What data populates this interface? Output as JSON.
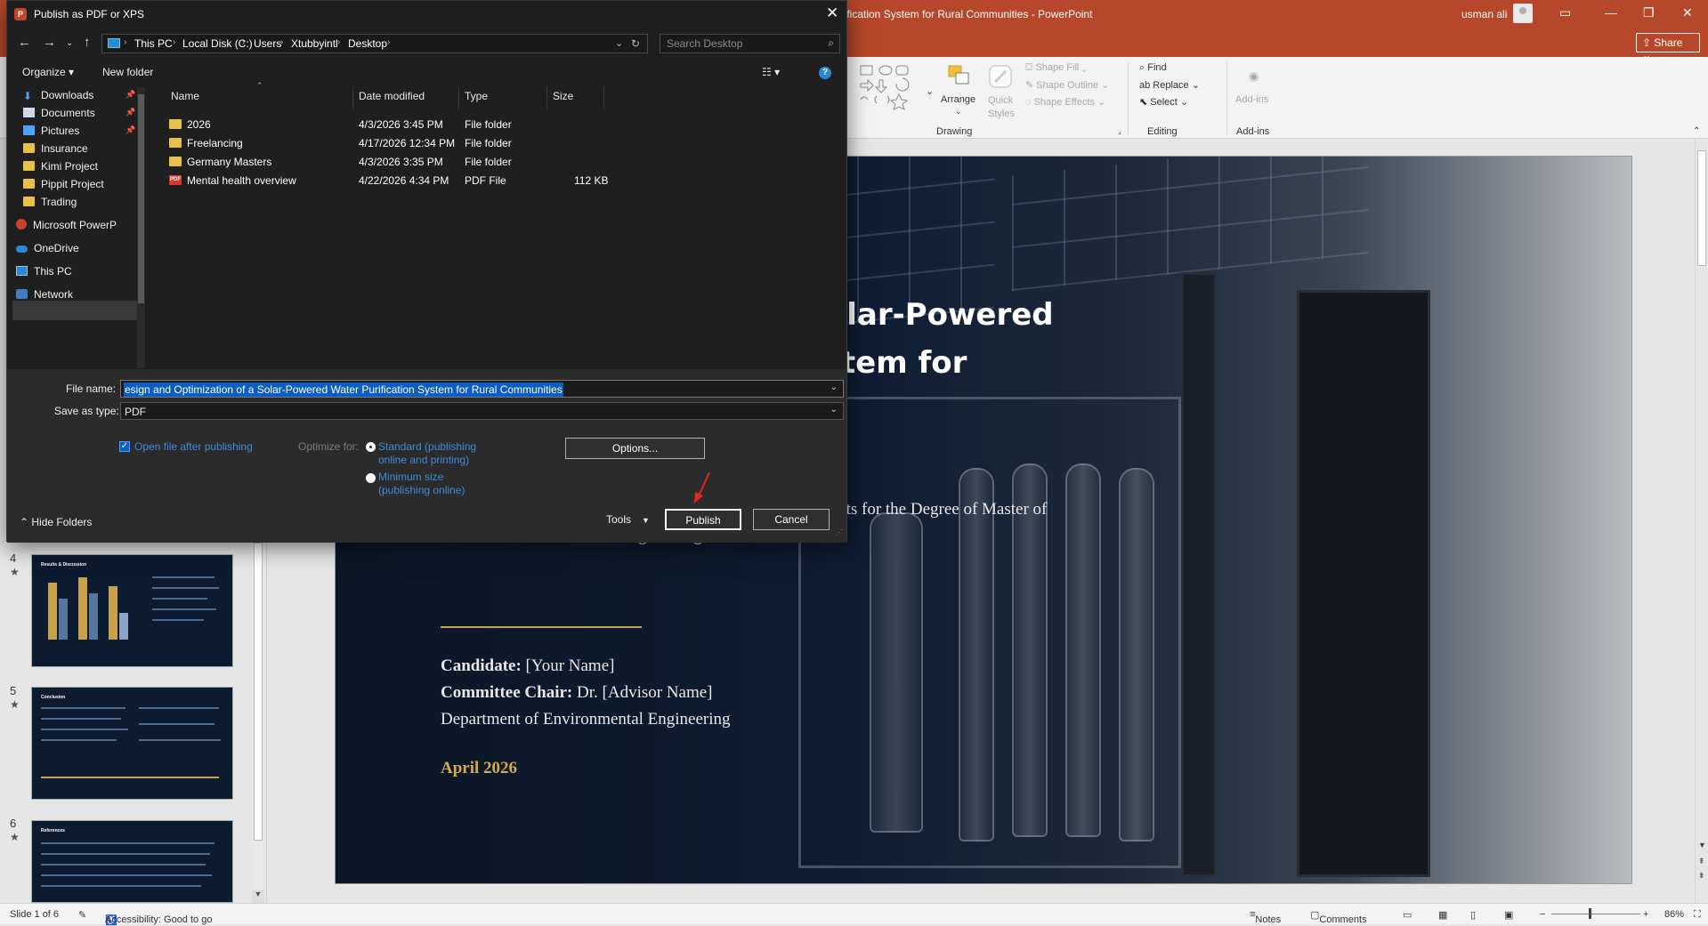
{
  "ppt": {
    "title": "Design and Optimization of a Solar-Powered Water Purification System for Rural Communities  -  PowerPoint",
    "title_visible": "urification System for Rural Communities  -  PowerPoint",
    "user": "usman ali",
    "share": "Share",
    "ribbon": {
      "shape_fill": "Shape Fill",
      "shape_outline": "Shape Outline",
      "shape_effects": "Shape Effects",
      "arrange": "Arrange",
      "quick_styles": "Quick Styles",
      "drawing": "Drawing",
      "find": "Find",
      "replace": "Replace",
      "select": "Select",
      "editing": "Editing",
      "addins_btn": "Add-ins",
      "addins_group": "Add-ins"
    },
    "slide": {
      "title_line1": "f a Solar-Powered",
      "title_line2": "n System for",
      "subtitle_line1": "A Thesis Presented in Partial Fulfillment of the Requirements for the Degree of Master of",
      "subtitle_line2": "Science in Environmental Engineering",
      "candidate_label": "Candidate:",
      "candidate_value": "[Your Name]",
      "chair_label": "Committee Chair:",
      "chair_value": "Dr. [Advisor Name]",
      "department": "Department of Environmental Engineering",
      "date": "April 2026"
    },
    "thumbnails": [
      {
        "num": "4",
        "title": "Results & Discussion"
      },
      {
        "num": "5",
        "title": "Conclusion"
      },
      {
        "num": "6",
        "title": "References"
      }
    ],
    "status": {
      "slide": "Slide 1 of 6",
      "accessibility": "Accessibility: Good to go",
      "notes": "Notes",
      "comments": "Comments",
      "zoom": "86%"
    }
  },
  "dialog": {
    "title": "Publish as PDF or XPS",
    "breadcrumb": [
      "This PC",
      "Local Disk (C:)",
      "Users",
      "Xtubbyintl",
      "Desktop"
    ],
    "search_placeholder": "Search Desktop",
    "organize": "Organize",
    "new_folder": "New folder",
    "nav_items": [
      {
        "label": "Downloads",
        "icon": "download-icon",
        "pinned": true
      },
      {
        "label": "Documents",
        "icon": "documents-icon",
        "pinned": true
      },
      {
        "label": "Pictures",
        "icon": "pictures-icon",
        "pinned": true
      },
      {
        "label": "Insurance",
        "icon": "folder-icon"
      },
      {
        "label": "Kimi Project",
        "icon": "folder-icon"
      },
      {
        "label": "Pippit Project",
        "icon": "folder-icon"
      },
      {
        "label": "Trading",
        "icon": "folder-icon"
      },
      {
        "label": "Microsoft PowerP",
        "icon": "powerpoint-icon"
      },
      {
        "label": "OneDrive",
        "icon": "cloud-icon"
      },
      {
        "label": "This PC",
        "icon": "computer-icon",
        "selected": true
      },
      {
        "label": "Network",
        "icon": "network-icon"
      }
    ],
    "columns": {
      "name": "Name",
      "date": "Date modified",
      "type": "Type",
      "size": "Size"
    },
    "files": [
      {
        "name": "2026",
        "date": "4/3/2026 3:45 PM",
        "type": "File folder",
        "size": "",
        "icon": "folder-icon"
      },
      {
        "name": "Freelancing",
        "date": "4/17/2026 12:34 PM",
        "type": "File folder",
        "size": "",
        "icon": "folder-icon"
      },
      {
        "name": "Germany Masters",
        "date": "4/3/2026 3:35 PM",
        "type": "File folder",
        "size": "",
        "icon": "folder-icon"
      },
      {
        "name": "Mental health overview",
        "date": "4/22/2026 4:34 PM",
        "type": "PDF File",
        "size": "112 KB",
        "icon": "pdf-icon"
      }
    ],
    "file_name_label": "File name:",
    "file_name_value": "esign and Optimization of a Solar-Powered Water Purification System for Rural Communities",
    "save_type_label": "Save as type:",
    "save_type_value": "PDF",
    "open_after": "Open file after publishing",
    "optimize_for": "Optimize for:",
    "standard_line1": "Standard (publishing",
    "standard_line2": "online and printing)",
    "minimum_line1": "Minimum size",
    "minimum_line2": "(publishing online)",
    "options": "Options...",
    "hide_folders": "Hide Folders",
    "tools": "Tools",
    "publish": "Publish",
    "cancel": "Cancel"
  }
}
